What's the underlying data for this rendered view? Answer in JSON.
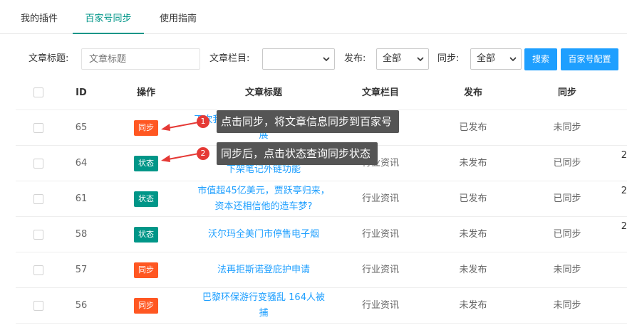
{
  "tabs": [
    {
      "label": "我的插件",
      "active": false
    },
    {
      "label": "百家号同步",
      "active": true
    },
    {
      "label": "使用指南",
      "active": false
    }
  ],
  "filter": {
    "title_label": "文章标题:",
    "title_placeholder": "文章标题",
    "category_label": "文章栏目:",
    "category_value": "",
    "publish_label": "发布:",
    "publish_value": "全部",
    "sync_label": "同步:",
    "sync_value": "全部",
    "search_button": "搜索",
    "config_button": "百家号配置"
  },
  "table": {
    "headers": {
      "id": "ID",
      "action": "操作",
      "title": "文章标题",
      "category": "文章栏目",
      "publish": "发布",
      "sync": "同步"
    },
    "rows": [
      {
        "id": "65",
        "action": "同步",
        "action_type": "sync",
        "title": "下次我们讨论人类的去向与方向发展",
        "category": "行业资讯",
        "publish": "已发布",
        "sync": "未同步",
        "overflow": ""
      },
      {
        "id": "64",
        "action": "状态",
        "action_type": "status",
        "title": "下架笔记外链功能",
        "category": "行业资讯",
        "publish": "未发布",
        "sync": "已同步",
        "overflow": "2"
      },
      {
        "id": "61",
        "action": "状态",
        "action_type": "status",
        "title": "市值超45亿美元，贾跃亭归来，资本还相信他的造车梦?",
        "category": "行业资讯",
        "publish": "已发布",
        "sync": "已同步",
        "overflow": "2"
      },
      {
        "id": "58",
        "action": "状态",
        "action_type": "status",
        "title": "沃尔玛全美门市停售电子烟",
        "category": "行业资讯",
        "publish": "未发布",
        "sync": "已同步",
        "overflow": "2"
      },
      {
        "id": "57",
        "action": "同步",
        "action_type": "sync",
        "title": "法再拒斯诺登庇护申请",
        "category": "行业资讯",
        "publish": "未发布",
        "sync": "未同步",
        "overflow": ""
      },
      {
        "id": "56",
        "action": "同步",
        "action_type": "sync",
        "title": "巴黎环保游行变骚乱 164人被捕",
        "category": "行业资讯",
        "publish": "未发布",
        "sync": "未同步",
        "overflow": ""
      }
    ]
  },
  "callouts": [
    {
      "number": "1",
      "text": "点击同步，将文章信息同步到百家号"
    },
    {
      "number": "2",
      "text": "同步后，点击状态查询同步状态"
    }
  ],
  "colors": {
    "accent": "#009688",
    "primary_button": "#1e9fff",
    "sync_tag": "#ff5722",
    "callout_badge": "#e53935"
  }
}
